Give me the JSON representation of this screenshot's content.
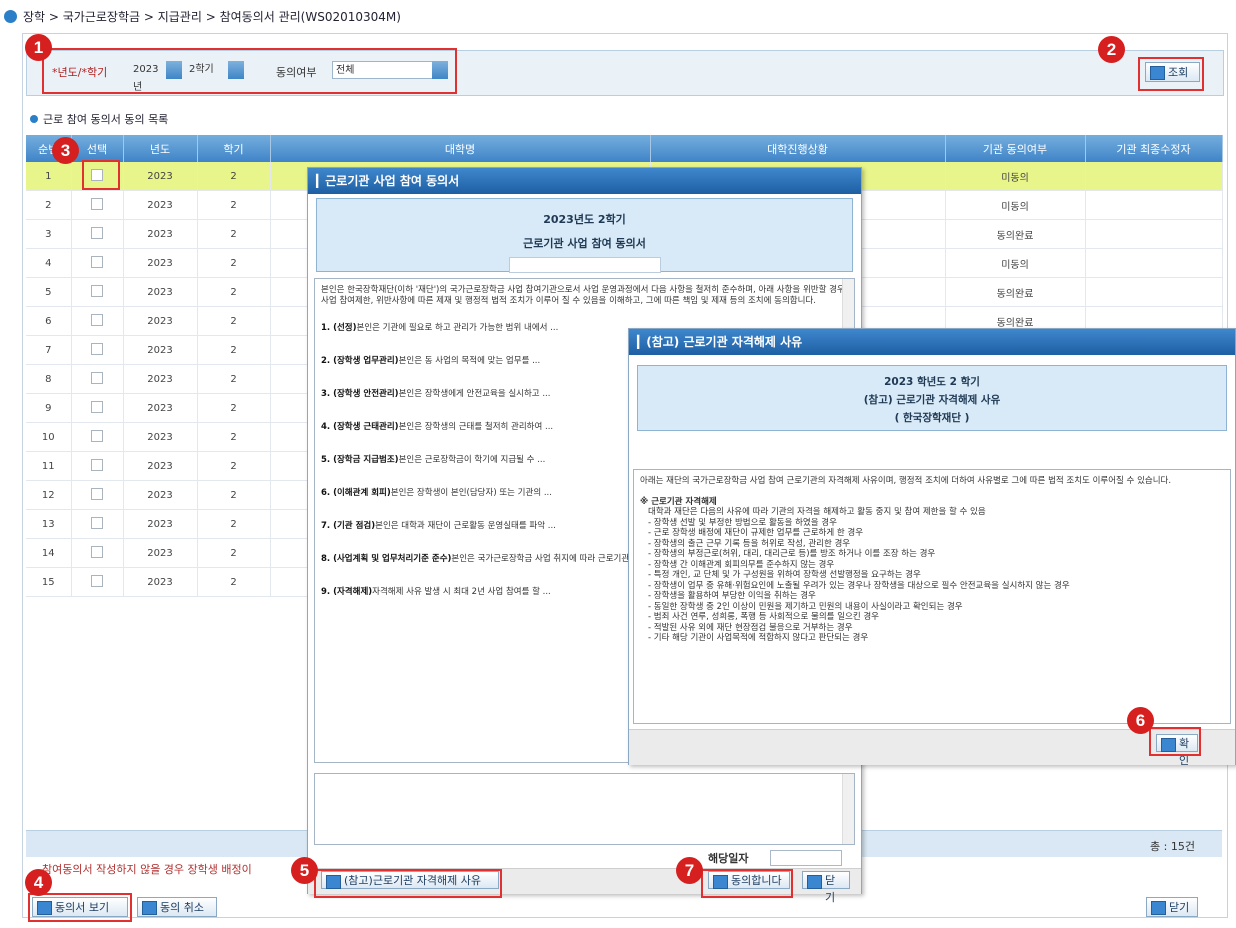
{
  "breadcrumb": "장학 > 국가근로장학금 > 지급관리 > 참여동의서 관리(WS02010304M)",
  "search": {
    "year_label": "*년도/*학기",
    "year_value": "2023년",
    "term_value": "2학기",
    "consent_label": "동의여부",
    "consent_value": "전체",
    "search_button": "조회"
  },
  "list_title": "근로 참여 동의서 동의 목록",
  "table": {
    "headers": [
      "순번",
      "선택",
      "년도",
      "학기",
      "대학명",
      "대학진행상황",
      "기관 동의여부",
      "기관 최종수정자"
    ],
    "rows": [
      {
        "no": "1",
        "year": "2023",
        "term": "2",
        "agree": "미동의"
      },
      {
        "no": "2",
        "year": "2023",
        "term": "2",
        "agree": "미동의"
      },
      {
        "no": "3",
        "year": "2023",
        "term": "2",
        "agree": "동의완료"
      },
      {
        "no": "4",
        "year": "2023",
        "term": "2",
        "agree": "미동의"
      },
      {
        "no": "5",
        "year": "2023",
        "term": "2",
        "agree": "동의완료"
      },
      {
        "no": "6",
        "year": "2023",
        "term": "2",
        "agree": "동의완료"
      },
      {
        "no": "7",
        "year": "2023",
        "term": "2",
        "agree": ""
      },
      {
        "no": "8",
        "year": "2023",
        "term": "2",
        "agree": ""
      },
      {
        "no": "9",
        "year": "2023",
        "term": "2",
        "agree": ""
      },
      {
        "no": "10",
        "year": "2023",
        "term": "2",
        "agree": ""
      },
      {
        "no": "11",
        "year": "2023",
        "term": "2",
        "agree": ""
      },
      {
        "no": "12",
        "year": "2023",
        "term": "2",
        "agree": ""
      },
      {
        "no": "13",
        "year": "2023",
        "term": "2",
        "agree": ""
      },
      {
        "no": "14",
        "year": "2023",
        "term": "2",
        "agree": ""
      },
      {
        "no": "15",
        "year": "2023",
        "term": "2",
        "agree": ""
      }
    ]
  },
  "total": "총 : 15건",
  "notice": "참여동의서 작성하지 않을 경우 장학생 배정이",
  "buttons": {
    "view_consent": "동의서 보기",
    "cancel_consent": "동의 취소",
    "close": "닫기"
  },
  "dialog1": {
    "title": "근로기관 사업 참여 동의서",
    "head_line1": "2023년도 2학기",
    "head_line2": "근로기관 사업 참여 동의서",
    "intro": "본인은 한국장학재단(이하 '재단')의 국가근로장학금 사업 참여기관으로서 사업 운영과정에서 다음 사항을 철저히 준수하며, 아래 사항을 위반할 경우 사업 참여제한, 위반사항에 따른 제재 및 행정적 법적 조치가 이루어 질 수 있음을 이해하고, 그에 따른 책임 및 제재 등의 조치에 동의합니다.",
    "items": [
      {
        "head": "1. (선정)",
        "text": "본인은 기관에 필요로 하고 관리가 가능한 범위 내에서 ..."
      },
      {
        "head": "2. (장학생 업무관리)",
        "text": "본인은 동 사업의 목적에 맞는 업무를 ..."
      },
      {
        "head": "3. (장학생 안전관리)",
        "text": "본인은 장학생에게 안전교육을 실시하고 ..."
      },
      {
        "head": "4. (장학생 근태관리)",
        "text": "본인은 장학생의 근태를 철저히 관리하여 ..."
      },
      {
        "head": "5. (장학금 지급범조)",
        "text": "본인은 근로장학금이 학기에 지급될 수 ..."
      },
      {
        "head": "6. (이해관계 회피)",
        "text": "본인은 장학생이 본인(담당자) 또는 기관의 ..."
      },
      {
        "head": "7. (기관 점검)",
        "text": "본인은 대학과 재단이 근로활동 운영실태를 파악 ..."
      },
      {
        "head": "8. (사업계획 및 업무처리기준 준수)",
        "text": "본인은 국가근로장학금 사업 취지에 따라 근로기관으로서의 의무를 성실하게 이행할 것 ..."
      },
      {
        "head": "9. (자격해제)",
        "text": "자격해제 사유 발생 시 최대 2년 사업 참여를 할 ..."
      }
    ],
    "date_label": "해당일자",
    "ref_button": "(참고)근로기관 자격해제 사유",
    "agree_button": "동의합니다",
    "close_button": "닫기"
  },
  "dialog2": {
    "title": "(참고) 근로기관 자격해제 사유",
    "head_line1": "2023 학년도 2 학기",
    "head_line2": "(참고) 근로기관 자격해제 사유",
    "head_line3": "( 한국장학재단 )",
    "intro": "아래는 재단의 국가근로장학금 사업 참여 근로기관의 자격해제 사유이며, 행정적 조치에 더하여 사유별로 그에 따른 법적 조치도 이루어질 수 있습니다.",
    "section": "※ 근로기관 자격해제",
    "section_desc": "대학과 재단은 다음의 사유에 따라 기관의 자격을 해제하고 활동 중지 및 참여 제한을 할 수 있음",
    "reasons": [
      "- 장학생 선발 및 부정한 방법으로 활동을 하였을 경우",
      "- 근로 장학생 배정에 재단이 규제한 업무를 근로하게 한 경우",
      "- 장학생의 출근 근무 기록 등을 허위로 작성, 관리한 경우",
      "- 장학생의 부정근로(허위, 대리, 대리근로 등)를 방조 하거나 이를 조장 하는 경우",
      "- 장학생 간 이해관계 회피의무를 준수하지 않는 경우",
      "- 특정 개인, 교 단체 및 가 구성원을 위하여 장학생 선발행정을 요구하는 경우",
      "- 장학생이 업무 중 유해·위험요인에 노출될 우려가 있는 경우나 장학생을 대상으로 필수 안전교육을 실시하지 않는 경우",
      "- 장학생을 활용하여 부당한 이익을 취하는 경우",
      "- 동일한 장학생 중 2인 이상이 민원을 제기하고 민원의 내용이 사실이라고 확인되는 경우",
      "- 범죄 사건 연루, 성희롱, 폭행 등 사회적으로 물의를 일으킨 경우",
      "- 적발된 사유 외에 재단 현장점검 불응으로 거부하는 경우",
      "- 기타 해당 기관이 사업목적에 적합하지 않다고 판단되는 경우"
    ],
    "ok_button": "확인"
  },
  "markers": [
    "1",
    "2",
    "3",
    "4",
    "5",
    "6",
    "7"
  ],
  "colors": {
    "header_blue": "#3f84c8",
    "selected_row": "#e8f58a",
    "marker_red": "#d62020"
  }
}
